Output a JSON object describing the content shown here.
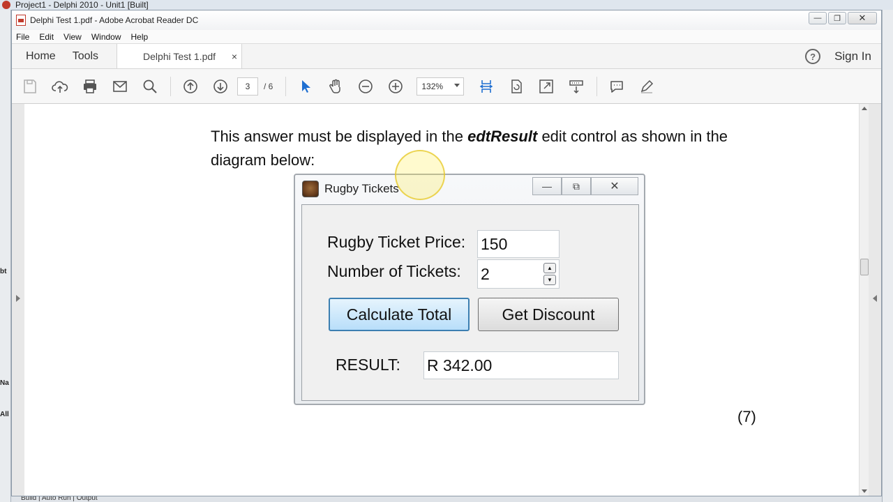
{
  "ide": {
    "title": "Project1 - Delphi 2010 - Unit1 [Built]",
    "side_letters": [
      "bt",
      "Na",
      "All"
    ],
    "bottom_tabs": "Build | Auto Run | Output"
  },
  "window": {
    "title": "Delphi Test 1.pdf - Adobe Acrobat Reader DC",
    "minimize": "—",
    "restore": "❐",
    "close": "✕"
  },
  "menu": [
    "File",
    "Edit",
    "View",
    "Window",
    "Help"
  ],
  "tabs": {
    "home": "Home",
    "tools": "Tools",
    "document": "Delphi Test 1.pdf",
    "close": "×",
    "help": "?",
    "sign_in": "Sign In"
  },
  "toolbar": {
    "page_current": "3",
    "page_total": "/ 6",
    "zoom": "132%"
  },
  "document": {
    "para_pre": "This answer must be displayed in the ",
    "para_bold": "edtResult",
    "para_post": " edit control as shown in the diagram below:",
    "marks": "(7)"
  },
  "form": {
    "title": "Rugby Tickets",
    "min": "—",
    "max": "⧉",
    "close": "✕",
    "price_label": "Rugby Ticket Price:",
    "price_value": "150",
    "tickets_label": "Number of Tickets:",
    "tickets_value": "2",
    "spin_up": "▲",
    "spin_down": "▼",
    "calc_button": "Calculate Total",
    "discount_button": "Get Discount",
    "result_label": "RESULT:",
    "result_value": "R 342.00"
  },
  "colors": {
    "accent_blue": "#3c7fb1",
    "cursor_highlight": "#ffec50"
  }
}
